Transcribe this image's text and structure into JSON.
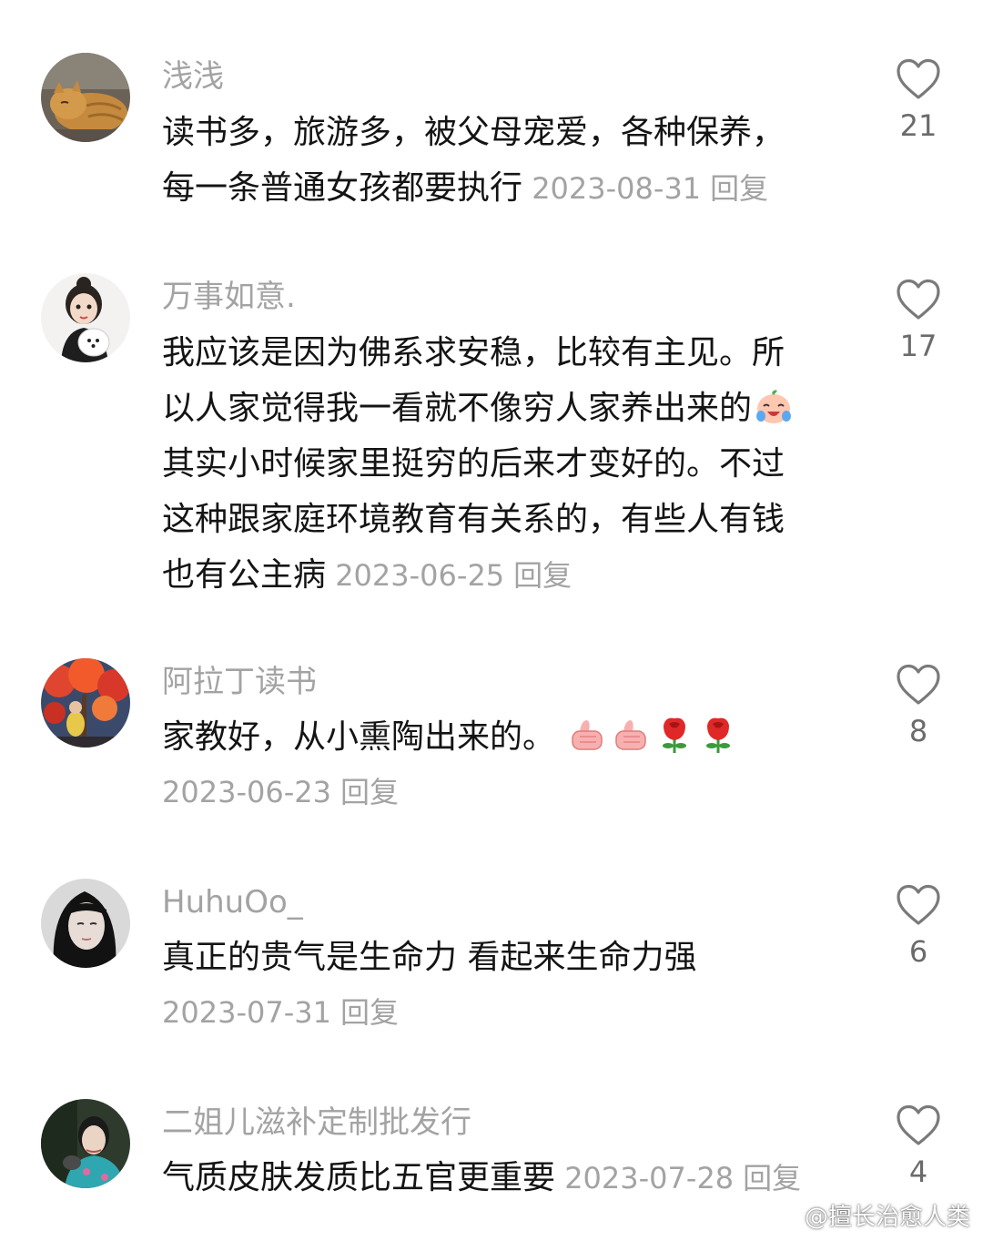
{
  "comments": [
    {
      "username": "浅浅",
      "text_lines": [
        "读书多，旅游多，被父母宠爱，各种保养，",
        "每一条普通女孩都要执行"
      ],
      "date": "2023-08-31",
      "reply": "回复",
      "likes": "21",
      "avatar_icon": "cat-avatar-icon"
    },
    {
      "username": "万事如意.",
      "text_lines": [
        "我应该是因为佛系求安稳，比较有主见。所",
        "以人家觉得我一看就不像穷人家养出来的",
        "其实小时候家里挺穷的后来才变好的。不过",
        "这种跟家庭环境教育有关系的，有些人有钱",
        "也有公主病"
      ],
      "date": "2023-06-25",
      "reply": "回复",
      "likes": "17",
      "avatar_icon": "girl-with-dog-avatar-icon",
      "inline_emoji": "laughing-crying-emoji-icon"
    },
    {
      "username": "阿拉丁读书",
      "text_lines": [
        "家教好，从小熏陶出来的。"
      ],
      "date": "2023-06-23",
      "reply": "回复",
      "likes": "8",
      "avatar_icon": "red-tree-avatar-icon",
      "emojis": [
        "thumbs-up-emoji-icon",
        "thumbs-up-emoji-icon",
        "rose-emoji-icon",
        "rose-emoji-icon"
      ]
    },
    {
      "username": "HuhuOo_",
      "text_lines": [
        "真正的贵气是生命力 看起来生命力强"
      ],
      "date": "2023-07-31",
      "reply": "回复",
      "likes": "6",
      "avatar_icon": "dark-hair-girl-avatar-icon"
    },
    {
      "username": "二姐儿滋补定制批发行",
      "text_lines": [
        "气质皮肤发质比五官更重要"
      ],
      "date": "2023-07-28",
      "reply": "回复",
      "likes": "4",
      "avatar_icon": "qipao-woman-avatar-icon"
    }
  ],
  "watermark": "@擅长治愈人类",
  "colors": {
    "username": "#a3a3a3",
    "text": "#141414",
    "meta": "#a3a3a3",
    "like_icon": "#7a7a7a"
  },
  "like_icon": "heart-outline-icon"
}
